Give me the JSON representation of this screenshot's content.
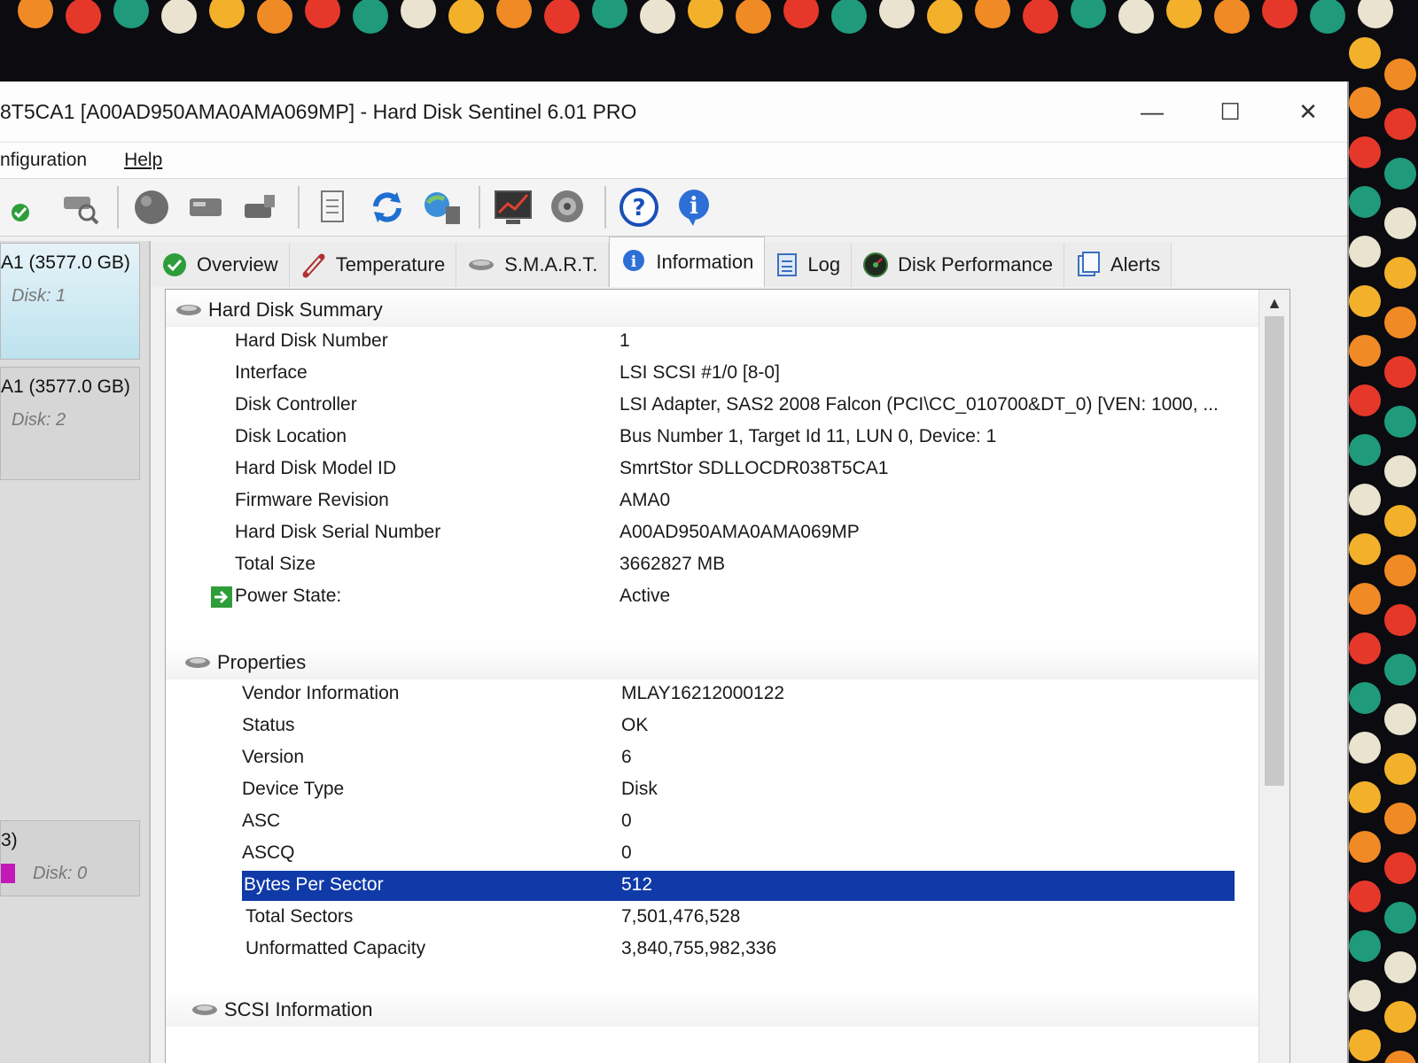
{
  "window": {
    "title": "8T5CA1 [A00AD950AMA0AMA069MP]  -  Hard Disk Sentinel 6.01 PRO",
    "minimize": "—",
    "maximize": "☐",
    "close": "✕"
  },
  "menu": [
    {
      "label": "nfiguration"
    },
    {
      "label": "Help"
    }
  ],
  "toolbar": [
    {
      "icon": "green-check-disk-icon"
    },
    {
      "icon": "disk-search-icon"
    },
    {
      "icon": "sphere-icon"
    },
    {
      "icon": "disk-drive-icon"
    },
    {
      "icon": "disk-tools-icon"
    },
    {
      "icon": "report-icon"
    },
    {
      "icon": "refresh-icon"
    },
    {
      "icon": "network-icon"
    },
    {
      "icon": "monitor-chart-icon"
    },
    {
      "icon": "speaker-icon"
    },
    {
      "icon": "help-icon"
    },
    {
      "icon": "info-icon"
    }
  ],
  "disks": [
    {
      "size": "A1 (3577.0 GB)",
      "disk": "Disk: 1"
    },
    {
      "size": "A1 (3577.0 GB)",
      "disk": "Disk: 2"
    },
    {
      "size": "3)",
      "disk": "Disk: 0"
    }
  ],
  "tabs": [
    {
      "label": "Overview",
      "icon": "check-circle-icon"
    },
    {
      "label": "Temperature",
      "icon": "thermometer-icon"
    },
    {
      "label": "S.M.A.R.T.",
      "icon": "disk-icon"
    },
    {
      "label": "Information",
      "icon": "info-icon"
    },
    {
      "label": "Log",
      "icon": "log-icon"
    },
    {
      "label": "Disk Performance",
      "icon": "gauge-icon"
    },
    {
      "label": "Alerts",
      "icon": "alerts-icon"
    }
  ],
  "summary": {
    "header": "Hard Disk Summary",
    "rows": [
      {
        "label": "Hard Disk Number",
        "value": "1"
      },
      {
        "label": "Interface",
        "value": "LSI  SCSI #1/0 [8-0]"
      },
      {
        "label": "Disk Controller",
        "value": "LSI Adapter, SAS2 2008 Falcon (PCI\\CC_010700&DT_0) [VEN: 1000, ..."
      },
      {
        "label": "Disk Location",
        "value": "Bus Number 1, Target Id 11, LUN 0, Device: 1"
      },
      {
        "label": "Hard Disk Model ID",
        "value": "SmrtStor SDLLOCDR038T5CA1"
      },
      {
        "label": "Firmware Revision",
        "value": "AMA0"
      },
      {
        "label": "Hard Disk Serial Number",
        "value": "A00AD950AMA0AMA069MP"
      },
      {
        "label": "Total Size",
        "value": "3662827 MB"
      },
      {
        "label": "Power State:",
        "value": "Active"
      }
    ]
  },
  "properties": {
    "header": "Properties",
    "rows": [
      {
        "label": "Vendor Information",
        "value": "MLAY16212000122"
      },
      {
        "label": "Status",
        "value": "OK"
      },
      {
        "label": "Version",
        "value": "6"
      },
      {
        "label": "Device Type",
        "value": "Disk"
      },
      {
        "label": "ASC",
        "value": "0"
      },
      {
        "label": "ASCQ",
        "value": "0"
      },
      {
        "label": "Bytes Per Sector",
        "value": "512"
      },
      {
        "label": "Total Sectors",
        "value": "7,501,476,528"
      },
      {
        "label": "Unformatted Capacity",
        "value": "3,840,755,982,336"
      }
    ]
  },
  "scsi": {
    "header": "SCSI Information"
  },
  "colors": {
    "selection": "#0f3aa8",
    "accent_green": "#2e9d3a"
  }
}
